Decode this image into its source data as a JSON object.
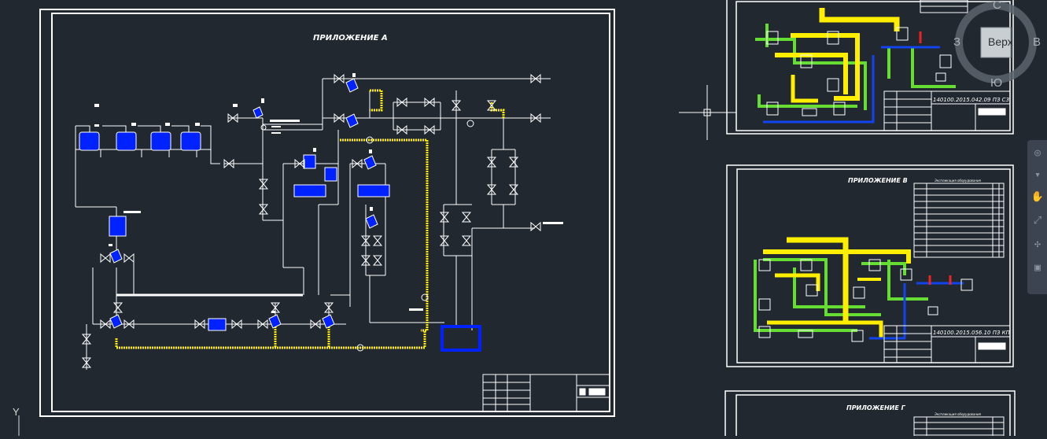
{
  "app": "AutoCAD model space",
  "main_sheet": {
    "title": "ПРИЛОЖЕНИЕ А"
  },
  "thumb_top": {
    "stamp_code": "140100.2015.042.09 ПЗ С3"
  },
  "thumb_mid": {
    "title": "ПРИЛОЖЕНИЕ В",
    "stamp_code": "140100.2015.056.10 ПЗ КП",
    "table_header": "Экспликация оборудования"
  },
  "thumb_bottom": {
    "title": "ПРИЛОЖЕНИЕ Г",
    "table_header": "Экспликация оборудования"
  },
  "viewcube": {
    "face_label": "Верх",
    "north": "С",
    "south": "Ю",
    "west": "З",
    "east": "В"
  },
  "ucs": {
    "y_label": "Y"
  },
  "colors": {
    "background": "#212830",
    "line": "#ffffff",
    "equipment": "#0022ff",
    "yellow_line": "#ffee00",
    "green_line": "#66dd33",
    "blue_line": "#1144ee",
    "red_mark": "#ee2222"
  }
}
